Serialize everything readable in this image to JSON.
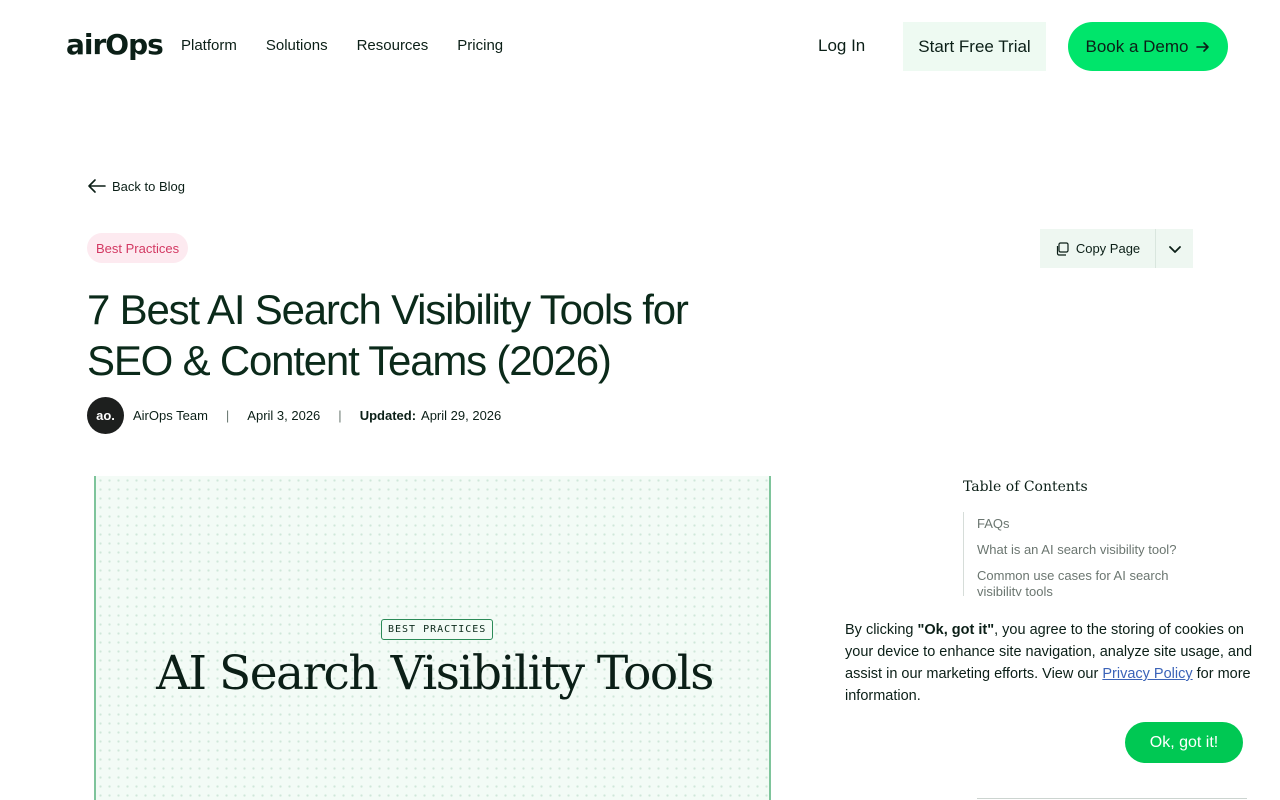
{
  "header": {
    "logo": "airOps",
    "nav": [
      "Platform",
      "Solutions",
      "Resources",
      "Pricing"
    ],
    "login": "Log In",
    "trial": "Start Free Trial",
    "demo": "Book a Demo"
  },
  "article": {
    "back": "Back to Blog",
    "tag": "Best Practices",
    "copy_page": "Copy Page",
    "title": "7 Best AI Search Visibility Tools for SEO & Content Teams (2026)",
    "author_initials": "ao.",
    "author": "AirOps Team",
    "date": "April 3, 2026",
    "updated_label": "Updated:",
    "updated_date": "April 29, 2026",
    "hero_badge": "BEST PRACTICES",
    "hero_title": "AI Search Visibility Tools"
  },
  "toc": {
    "title": "Table of Contents",
    "items": [
      "FAQs",
      "What is an AI search visibility tool?",
      "Common use cases for AI search visibility tools"
    ]
  },
  "cookie": {
    "part1": "By clicking ",
    "bold": "\"Ok, got it\"",
    "part2": ", you agree to the storing of cookies on your device to enhance site navigation, analyze site usage, and assist in our marketing efforts. View our ",
    "link": "Privacy Policy",
    "part3": " for more information.",
    "button": "Ok, got it!"
  },
  "colors": {
    "accent_green": "#00e56b",
    "ok_green": "#00c853",
    "tag_pink": "#d33963",
    "link_blue": "#3b63b8"
  }
}
